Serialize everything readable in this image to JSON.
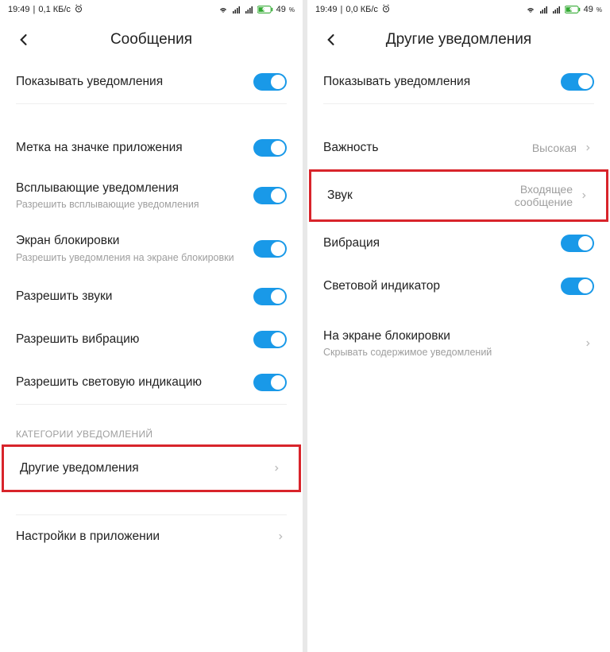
{
  "status": {
    "time": "19:49",
    "speed_left": "0,1 КБ/с",
    "speed_right": "0,0 КБ/с",
    "battery": "49",
    "battery_unit": "%"
  },
  "left": {
    "title": "Сообщения",
    "show_notifications": "Показывать уведомления",
    "badge": "Метка на значке приложения",
    "popup_label": "Всплывающие уведомления",
    "popup_sub": "Разрешить всплывающие уведомления",
    "lock_label": "Экран блокировки",
    "lock_sub": "Разрешить уведомления на экране блокировки",
    "allow_sounds": "Разрешить звуки",
    "allow_vibration": "Разрешить вибрацию",
    "allow_light": "Разрешить световую индикацию",
    "section": "КАТЕГОРИИ УВЕДОМЛЕНИЙ",
    "other": "Другие уведомления",
    "app_settings": "Настройки в приложении"
  },
  "right": {
    "title": "Другие уведомления",
    "show_notifications": "Показывать уведомления",
    "importance_label": "Важность",
    "importance_value": "Высокая",
    "sound_label": "Звук",
    "sound_value": "Входящее сообщение",
    "vibration": "Вибрация",
    "light": "Световой индикатор",
    "lock_label": "На экране блокировки",
    "lock_sub": "Скрывать содержимое уведомлений"
  }
}
